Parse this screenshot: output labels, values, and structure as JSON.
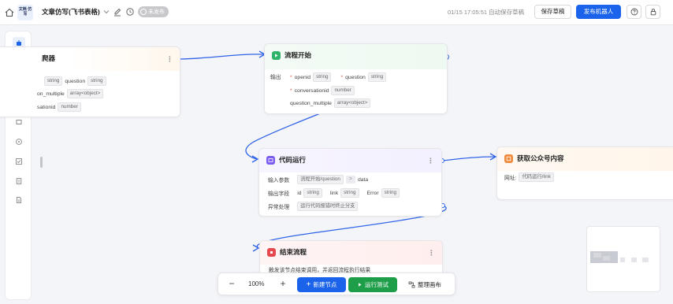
{
  "topbar": {
    "logo_text": "文档 仿写",
    "app_title": "文章仿写(飞书表格)",
    "status_badge": "未发布",
    "autosave": "01/15 17:05:51 自动保存草稿",
    "save_draft": "保存草稿",
    "publish_bot": "发布机器人"
  },
  "nodes": {
    "left_partial": {
      "title": "爬器",
      "row1": {
        "tag1": "string",
        "field": "question",
        "tag2": "string"
      },
      "row2": {
        "field": "on_multiple",
        "tag": "array<object>"
      },
      "row3": {
        "field": "sationid",
        "tag": "number"
      }
    },
    "flow_start": {
      "title": "流程开始",
      "output_label": "输出",
      "params": [
        {
          "name": "openid",
          "type": "string"
        },
        {
          "name": "question",
          "type": "string"
        },
        {
          "name": "conversationid",
          "type": "number"
        },
        {
          "name": "question_multiple",
          "type": "array<object>"
        }
      ]
    },
    "code_run": {
      "title": "代码运行",
      "input_label": "输入参数",
      "input_value": "流程开始/question",
      "input_target": "data",
      "output_label": "输出字段",
      "outputs": [
        {
          "name": "id",
          "type": "string"
        },
        {
          "name": "link",
          "type": "string"
        },
        {
          "name": "Error",
          "type": "string"
        }
      ],
      "exception_label": "异常处理",
      "exception_value": "运行代码报错时终止分支"
    },
    "fetch_content": {
      "title": "获取公众号内容",
      "url_label": "网址:",
      "url_value": "代码运行/link"
    },
    "end_flow": {
      "title": "结束流程",
      "desc": "触发该节点结束调用，并返回流程执行结果"
    }
  },
  "toolbar": {
    "zoom": "100%",
    "add_node": "新建节点",
    "run_test": "运行测试",
    "auto_layout": "整理画布"
  },
  "colors": {
    "primary": "#1a63ea",
    "run": "#1f9e4a",
    "flow_start_icon": "#2fb36b",
    "code_run_icon": "#7b5cf0",
    "fetch_icon": "#f08a3c",
    "end_icon": "#e5484d",
    "wire": "#2f63e8"
  }
}
